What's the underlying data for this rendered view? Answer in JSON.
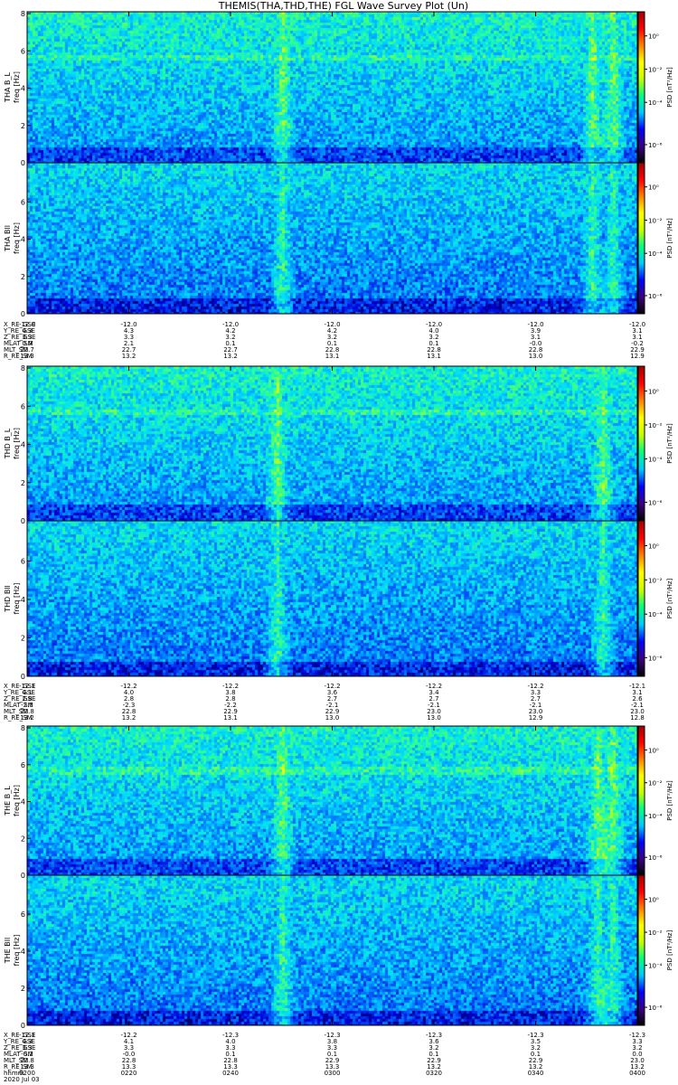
{
  "title": "THEMIS(THA,THD,THE) FGL Wave Survey Plot (Un)",
  "colorbar": {
    "label": "PSD [nT²/Hz]",
    "ticks": [
      "10⁰",
      "10⁻²",
      "10⁻⁴",
      "10⁻⁶"
    ],
    "colors": [
      "#000000",
      "#3b0082",
      "#0000ff",
      "#00c8ff",
      "#00ff80",
      "#c8ff00",
      "#ffff00",
      "#ff8000",
      "#ff0000",
      "#a00000"
    ]
  },
  "time_axis": {
    "labels": [
      "0200",
      "0220",
      "0240",
      "0300",
      "0320",
      "0340",
      "0400"
    ],
    "hhmm_label": "hhmm",
    "date": "2020 Jul 03"
  },
  "chart_data": [
    {
      "type": "heatmap",
      "probe": "THA",
      "panels": [
        {
          "ylabel": "THA B_L",
          "unit": "freq [Hz]",
          "yticks": [
            0,
            2,
            4,
            6,
            8
          ],
          "ylim": [
            0,
            8
          ]
        },
        {
          "ylabel": "THA Bll",
          "unit": "freq [Hz]",
          "yticks": [
            0,
            2,
            4,
            6
          ],
          "ylim": [
            0,
            8
          ]
        }
      ],
      "activity_times": [
        "0250",
        "0351",
        "0355"
      ],
      "ephemeris": [
        {
          "name": "X_RE_GSE",
          "values": [
            "-12.0",
            "-12.0",
            "-12.0",
            "-12.0",
            "-12.0",
            "-12.0",
            "-12.0"
          ]
        },
        {
          "name": "Y_RE_GSE",
          "values": [
            "4.3",
            "4.3",
            "4.2",
            "4.2",
            "4.0",
            "3.9",
            "3.1"
          ]
        },
        {
          "name": "Z_RE_GSE",
          "values": [
            "3.3",
            "3.3",
            "3.2",
            "3.2",
            "3.2",
            "3.1",
            "3.1"
          ]
        },
        {
          "name": "MLAT_SM",
          "values": [
            "0.0",
            "2.1",
            "0.1",
            "0.1",
            "0.1",
            "-0.0",
            "-0.2"
          ]
        },
        {
          "name": "MLT_SM",
          "values": [
            "22.7",
            "22.7",
            "22.7",
            "22.8",
            "22.8",
            "22.8",
            "22.9"
          ]
        },
        {
          "name": "R_RE_SM",
          "values": [
            "13.3",
            "13.2",
            "13.2",
            "13.1",
            "13.1",
            "13.0",
            "12.9"
          ]
        }
      ]
    },
    {
      "type": "heatmap",
      "probe": "THD",
      "panels": [
        {
          "ylabel": "THD B_L",
          "unit": "freq [Hz]",
          "yticks": [
            0,
            2,
            4,
            6,
            8
          ],
          "ylim": [
            0,
            8
          ]
        },
        {
          "ylabel": "THD Bll",
          "unit": "freq [Hz]",
          "yticks": [
            0,
            2,
            4,
            6
          ],
          "ylim": [
            0,
            8
          ]
        }
      ],
      "activity_times": [
        "0249",
        "0353"
      ],
      "ephemeris": [
        {
          "name": "X_RE_GSE",
          "values": [
            "-12.1",
            "-12.2",
            "-12.2",
            "-12.2",
            "-12.2",
            "-12.2",
            "-12.1"
          ]
        },
        {
          "name": "Y_RE_GSE",
          "values": [
            "4.1",
            "4.0",
            "3.8",
            "3.6",
            "3.4",
            "3.3",
            "3.1"
          ]
        },
        {
          "name": "Z_RE_GSE",
          "values": [
            "2.8",
            "2.8",
            "2.8",
            "2.7",
            "2.7",
            "2.7",
            "2.6"
          ]
        },
        {
          "name": "MLAT_SM",
          "values": [
            "-2.5",
            "-2.3",
            "-2.2",
            "-2.1",
            "-2.1",
            "-2.1",
            "-2.1"
          ]
        },
        {
          "name": "MLT_SM",
          "values": [
            "22.8",
            "22.8",
            "22.9",
            "22.9",
            "23.0",
            "23.0",
            "23.0"
          ]
        },
        {
          "name": "R_RE_SM",
          "values": [
            "13.2",
            "13.2",
            "13.1",
            "13.0",
            "13.0",
            "12.9",
            "12.8"
          ]
        }
      ]
    },
    {
      "type": "heatmap",
      "probe": "THE",
      "panels": [
        {
          "ylabel": "THE B_L",
          "unit": "freq [Hz]",
          "yticks": [
            0,
            2,
            4,
            6,
            8
          ],
          "ylim": [
            0,
            8
          ]
        },
        {
          "ylabel": "THE Bll",
          "unit": "freq [Hz]",
          "yticks": [
            0,
            2,
            4,
            6
          ],
          "ylim": [
            0,
            8
          ]
        }
      ],
      "activity_times": [
        "0250",
        "0352",
        "0355"
      ],
      "ephemeris": [
        {
          "name": "X_RE_GSE",
          "values": [
            "-12.1",
            "-12.2",
            "-12.3",
            "-12.3",
            "-12.3",
            "-12.3",
            "-12.3"
          ]
        },
        {
          "name": "Y_RE_GSE",
          "values": [
            "4.3",
            "4.1",
            "4.0",
            "3.8",
            "3.6",
            "3.5",
            "3.3"
          ]
        },
        {
          "name": "Z_RE_GSE",
          "values": [
            "3.3",
            "3.3",
            "3.3",
            "3.3",
            "3.2",
            "3.2",
            "3.2"
          ]
        },
        {
          "name": "MLAT_SM",
          "values": [
            "-0.2",
            "-0.0",
            "0.1",
            "0.1",
            "0.1",
            "0.1",
            "0.0"
          ]
        },
        {
          "name": "MLT_SM",
          "values": [
            "22.8",
            "22.8",
            "22.8",
            "22.9",
            "22.9",
            "22.9",
            "23.0"
          ]
        },
        {
          "name": "R_RE_SM",
          "values": [
            "13.3",
            "13.3",
            "13.3",
            "13.3",
            "13.2",
            "13.2",
            "13.2"
          ]
        }
      ]
    }
  ]
}
